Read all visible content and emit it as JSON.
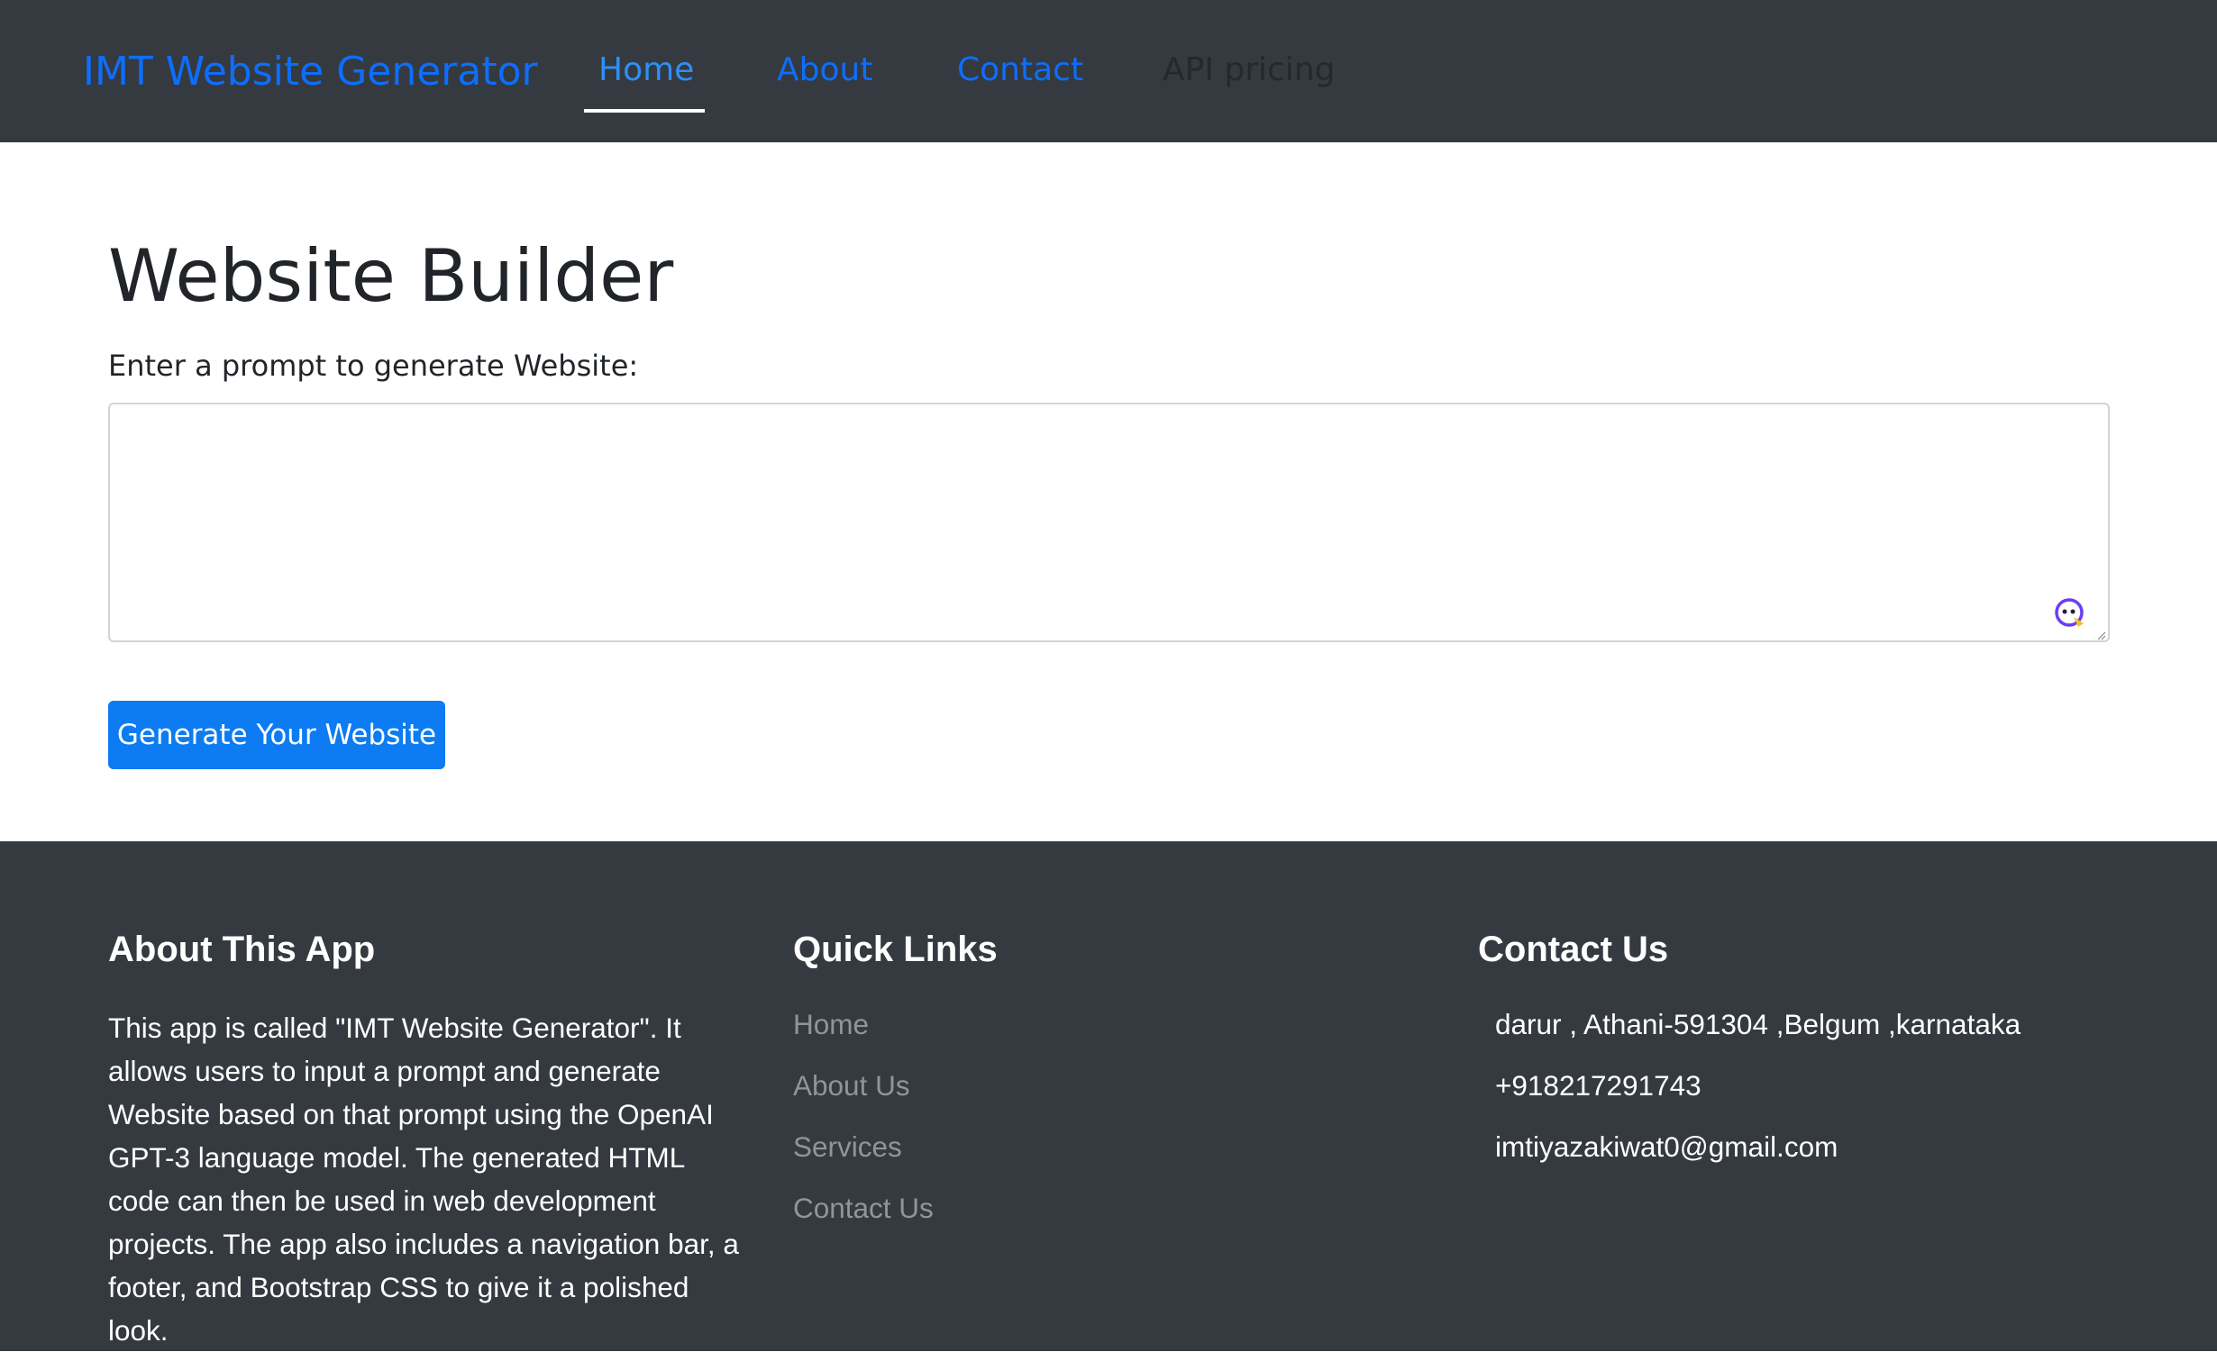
{
  "navbar": {
    "brand": "IMT Website Generator",
    "links": [
      {
        "label": "Home",
        "active": true
      },
      {
        "label": "About"
      },
      {
        "label": "Contact"
      },
      {
        "label": "API pricing"
      }
    ]
  },
  "main": {
    "title": "Website Builder",
    "prompt_label": "Enter a prompt to generate Website:",
    "prompt_value": "",
    "button_label": "Generate Your Website"
  },
  "footer": {
    "about": {
      "heading": "About This App",
      "text": "This app is called \"IMT Website Generator\". It allows users to input a prompt and generate Website based on that prompt using the OpenAI GPT-3 language model. The generated HTML code can then be used in web development projects. The app also includes a navigation bar, a footer, and Bootstrap CSS to give it a polished look."
    },
    "quick_links": {
      "heading": "Quick Links",
      "items": [
        "Home",
        "About Us",
        "Services",
        "Contact Us"
      ]
    },
    "contact": {
      "heading": "Contact Us",
      "address": "darur , Athani-591304 ,Belgum ,karnataka",
      "phone": "+918217291743",
      "email": "imtiyazakiwat0@gmail.com"
    }
  },
  "colors": {
    "navbar_bg": "#343a40",
    "link_blue": "#0d6efd",
    "button_bg": "#0d7cf2",
    "footer_bg": "#343a40",
    "footer_link_gray": "#8f959a"
  },
  "icons": {
    "assistant": "assistant-face-icon",
    "resize": "resize-handle-icon"
  }
}
